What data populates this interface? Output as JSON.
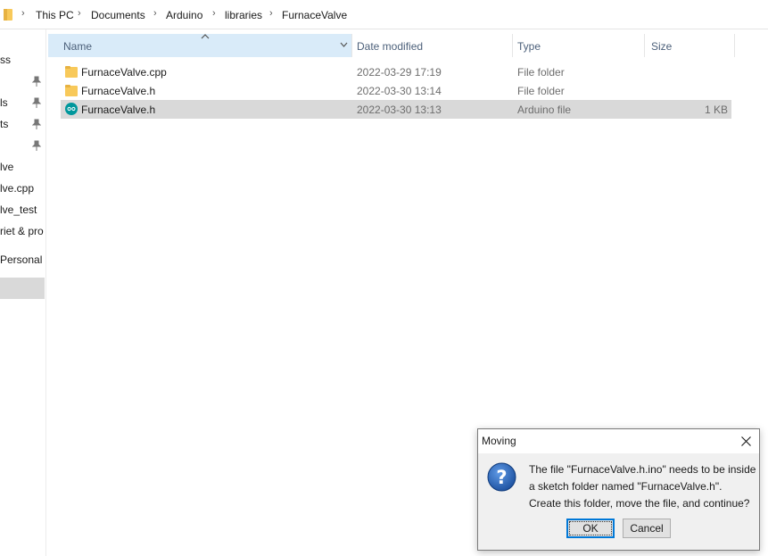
{
  "address_bar": {
    "crumbs": [
      "This PC",
      "Documents",
      "Arduino",
      "libraries",
      "FurnaceValve"
    ]
  },
  "nav_pane": {
    "items": [
      {
        "label": "ss",
        "pinned": false
      },
      {
        "label": "",
        "pinned": true
      },
      {
        "label": "ls",
        "pinned": true
      },
      {
        "label": "ts",
        "pinned": true
      },
      {
        "label": "",
        "pinned": true
      },
      {
        "label": "lve",
        "pinned": false
      },
      {
        "label": "lve.cpp",
        "pinned": false
      },
      {
        "label": "lve_test",
        "pinned": false
      },
      {
        "label": "riet & pro",
        "pinned": false
      },
      {
        "label": "Personal",
        "pinned": false
      }
    ]
  },
  "columns": {
    "name": "Name",
    "date": "Date modified",
    "type": "Type",
    "size": "Size"
  },
  "files": [
    {
      "icon": "folder-icon",
      "name": "FurnaceValve.cpp",
      "date": "2022-03-29 17:19",
      "type": "File folder",
      "size": ""
    },
    {
      "icon": "folder-icon",
      "name": "FurnaceValve.h",
      "date": "2022-03-30 13:14",
      "type": "File folder",
      "size": ""
    },
    {
      "icon": "arduino-file-icon",
      "name": "FurnaceValve.h",
      "date": "2022-03-30 13:13",
      "type": "Arduino file",
      "size": "1 KB"
    }
  ],
  "dialog": {
    "title": "Moving",
    "lines": [
      "The file \"FurnaceValve.h.ino\" needs to be inside",
      "a sketch folder named \"FurnaceValve.h\".",
      "Create this folder, move the file, and continue?"
    ],
    "ok_label": "OK",
    "cancel_label": "Cancel"
  },
  "colors": {
    "folder": "#f8c95a",
    "arduino": "#00979c",
    "selection": "#d9d9d9",
    "header_hover": "#d9ebf9",
    "accent": "#0078d7"
  }
}
